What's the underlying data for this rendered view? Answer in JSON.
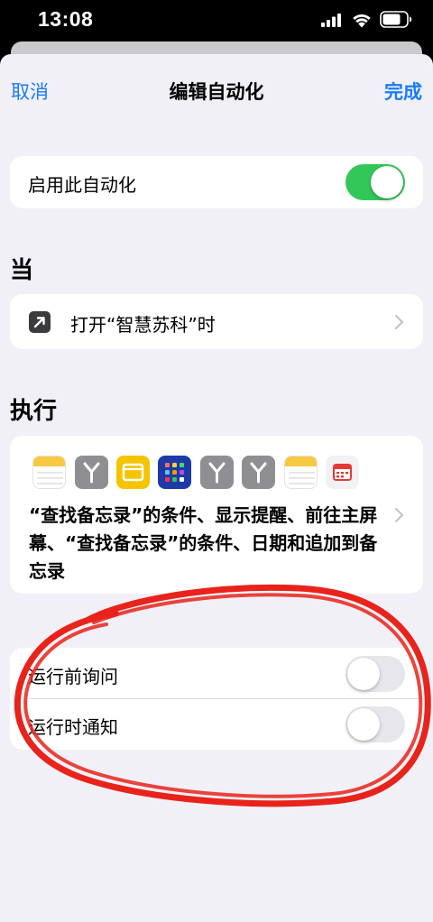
{
  "status_bar": {
    "time": "13:08",
    "icons": [
      "signal-icon",
      "wifi-icon",
      "battery-icon"
    ]
  },
  "nav": {
    "cancel_label": "取消",
    "title": "编辑自动化",
    "done_label": "完成"
  },
  "enable": {
    "label": "启用此自动化",
    "enabled": true
  },
  "when": {
    "header": "当",
    "trigger_label": "打开“智慧苏科”时",
    "trigger_icon": "arrow-up-right-icon"
  },
  "actions": {
    "header": "执行",
    "icons": [
      "notes-icon",
      "branch-icon",
      "window-icon",
      "home-screen-icon",
      "branch-icon",
      "branch-icon",
      "notes-icon",
      "calendar-icon"
    ],
    "description": "“查找备忘录”的条件、显示提醒、前往主屏幕、“查找备忘录”的条件、日期和追加到备忘录"
  },
  "options": [
    {
      "label": "运行前询问",
      "enabled": false
    },
    {
      "label": "运行时通知",
      "enabled": false
    }
  ],
  "colors": {
    "accent": "#1a7cf5",
    "toggle_on": "#33c759",
    "annotation": "#e8231b",
    "background": "#f1f0f6"
  }
}
